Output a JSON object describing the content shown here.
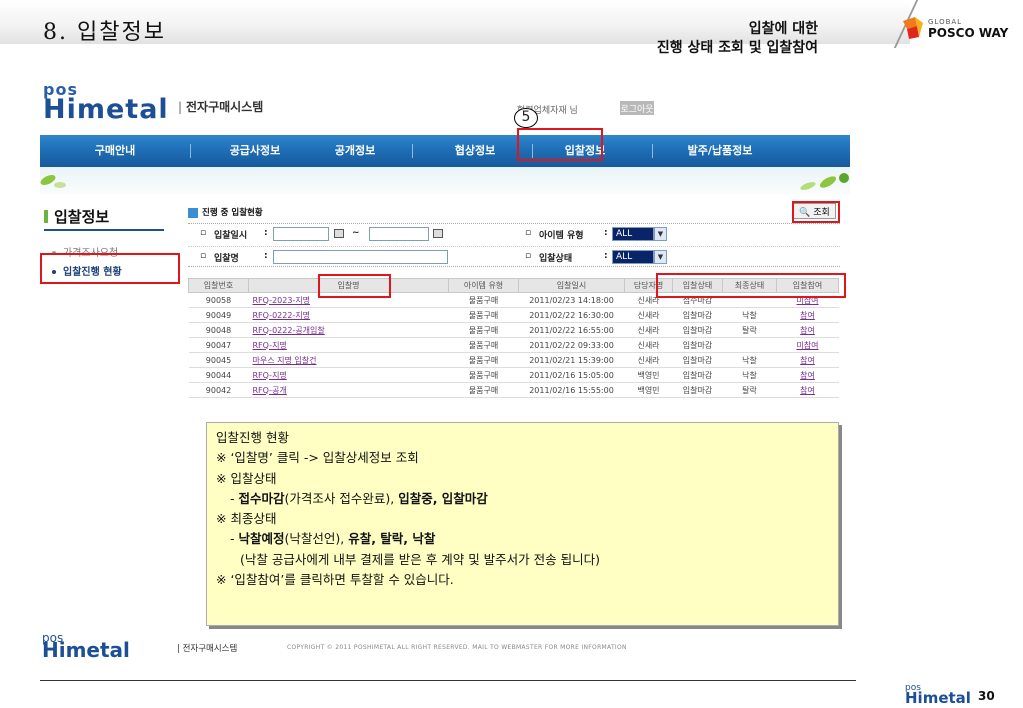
{
  "slide": {
    "title": "8. 입찰정보",
    "subtitle_line1": "입찰에 대한",
    "subtitle_line2": "진행 상태 조회 및 입찰참여",
    "brand_small": "GLOBAL",
    "brand_large": "POSCO WAY",
    "page_number": "30"
  },
  "app": {
    "logo_top": "pos",
    "logo_bottom": "Himetal",
    "site_name": "전자구매시스템",
    "user_label": "협력업체자재 님",
    "logout_label": "로그아웃",
    "callout_number": "5",
    "nav": [
      "구매안내",
      "공급사정보",
      "공개정보",
      "협상정보",
      "입찰정보",
      "발주/납품정보"
    ]
  },
  "sidebar": {
    "title": "입찰정보",
    "items": [
      "가격조사요청",
      "입찰진행 현황"
    ]
  },
  "content": {
    "section_title": "진행 중 입찰현황",
    "search_label": "조회",
    "filters": {
      "bid_date_label": "입찰일시",
      "bid_name_label": "입찰명",
      "item_type_label": "아이템 유형",
      "item_type_value": "ALL",
      "bid_status_label": "입찰상태",
      "bid_status_value": "ALL",
      "range_sep": "~",
      "colon": ":"
    },
    "columns": [
      "입찰번호",
      "입찰명",
      "아이템 유형",
      "입찰일시",
      "담당자명",
      "입찰상태",
      "최종상태",
      "입찰참여"
    ],
    "rows": [
      [
        "90058",
        "RFQ-2023-지명",
        "물품구매",
        "2011/02/23 14:18:00",
        "신새라",
        "접수마감",
        "",
        "미참여"
      ],
      [
        "90049",
        "RFQ-0222-지명",
        "물품구매",
        "2011/02/22 16:30:00",
        "신새라",
        "입찰마감",
        "낙찰",
        "참여"
      ],
      [
        "90048",
        "RFQ-0222-공개입찰",
        "물품구매",
        "2011/02/22 16:55:00",
        "신새라",
        "입찰마감",
        "탈락",
        "참여"
      ],
      [
        "90047",
        "RFQ-지명",
        "물품구매",
        "2011/02/22 09:33:00",
        "신새라",
        "입찰마감",
        "",
        "미참여"
      ],
      [
        "90045",
        "마우스 지명 입찰건",
        "물품구매",
        "2011/02/21 15:39:00",
        "신새라",
        "입찰마감",
        "낙찰",
        "참여"
      ],
      [
        "90044",
        "RFQ-지명",
        "물품구매",
        "2011/02/16 15:05:00",
        "백영민",
        "입찰마감",
        "낙찰",
        "참여"
      ],
      [
        "90042",
        "RFQ-공개",
        "물품구매",
        "2011/02/16 15:55:00",
        "백영민",
        "입찰마감",
        "탈락",
        "참여"
      ]
    ]
  },
  "note": {
    "title": "입찰진행 현황",
    "line1": "※ ‘입찰명’ 클릭 -> 입찰상세정보 조회",
    "line2": "※ 입찰상태",
    "line3_prefix": "- ",
    "line3_bold1": "접수마감",
    "line3_plain1": "(가격조사 접수완료), ",
    "line3_bold2": "입찰중, 입찰마감",
    "line4": "※ 최종상태",
    "line5_prefix": "- ",
    "line5_bold1": "낙찰예정",
    "line5_plain1": "(낙찰선언), ",
    "line5_bold2": "유찰, 탈락, 낙찰",
    "line6": "(낙찰 공급사에게 내부 결제를 받은 후 계약 및 발주서가 전송 됩니다)",
    "line7": "※ ‘입찰참여’를 클릭하면 투찰할 수 있습니다."
  },
  "footer": {
    "logo_top": "pos",
    "logo_bottom": "Himetal",
    "site": "| 전자구매시스템",
    "copyright": "COPYRIGHT © 2011 POSHIMETAL ALL RIGHT RESERVED. MAIL TO WEBMASTER FOR MORE INFORMATION"
  },
  "colors": {
    "nav_blue": "#1f6fb7",
    "highlight_red": "#e0161d",
    "note_yellow": "#ffffc4",
    "link_purple": "#7a2d90"
  }
}
